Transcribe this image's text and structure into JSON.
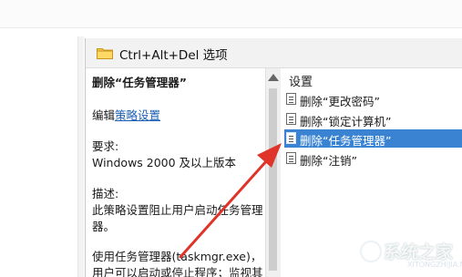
{
  "window": {
    "title": "Ctrl+Alt+Del 选项",
    "icon": "folder-icon"
  },
  "description": {
    "policy_name": "删除“任务管理器”",
    "edit_prefix": "编辑",
    "edit_link": "策略设置",
    "requirements_label": "要求:",
    "requirements_value": "Windows 2000 及以上版本",
    "description_label": "描述:",
    "description_line1": "此策略设置阻止用户启动任务管理",
    "description_line2": "器。",
    "description_line3": "使用任务管理器(taskmgr.exe)，",
    "description_line4": "用户可以启动或停止程序；监视其"
  },
  "settings": {
    "title": "设置",
    "items": [
      {
        "label": "删除“更改密码”",
        "icon": "policy-setting-icon",
        "selected": false
      },
      {
        "label": "删除“锁定计算机”",
        "icon": "policy-setting-icon",
        "selected": false
      },
      {
        "label": "删除“任务管理器”",
        "icon": "policy-setting-icon",
        "selected": true
      },
      {
        "label": "删除“注销”",
        "icon": "policy-setting-icon",
        "selected": false
      }
    ]
  },
  "watermark": {
    "text": "系统之家",
    "subtext": "XITONGZHIJIA.NET"
  },
  "colors": {
    "selection": "#3a83d3",
    "link": "#1a5fb4",
    "annotation_arrow": "#e0342a"
  }
}
